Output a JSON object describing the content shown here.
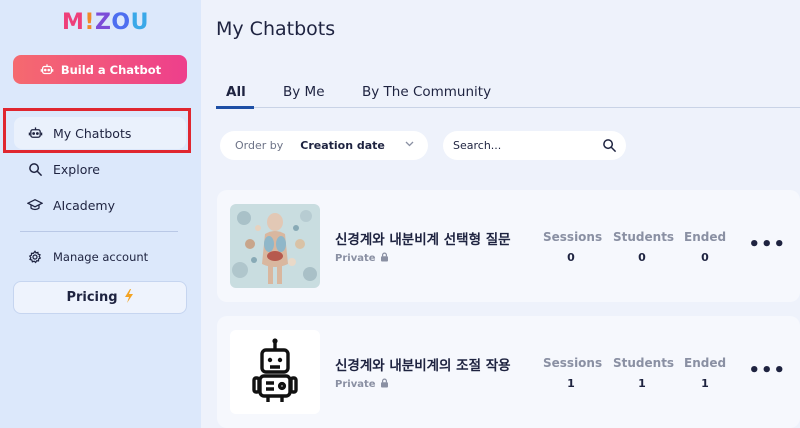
{
  "brand": {
    "logo": [
      "M",
      "!",
      "Z",
      "O",
      "U"
    ]
  },
  "sidebar": {
    "build_label": "Build a Chatbot",
    "items": [
      {
        "label": "My Chatbots",
        "icon": "robot-icon"
      },
      {
        "label": "Explore",
        "icon": "search-icon"
      },
      {
        "label": "AIcademy",
        "icon": "graduation-cap-icon"
      }
    ],
    "manage_label": "Manage account",
    "pricing_label": "Pricing",
    "pricing_icon": "bolt-icon"
  },
  "main": {
    "title": "My Chatbots",
    "tabs": [
      {
        "label": "All",
        "active": true
      },
      {
        "label": "By Me",
        "active": false
      },
      {
        "label": "By The Community",
        "active": false
      }
    ],
    "order": {
      "label": "Order by",
      "value": "Creation date"
    },
    "search": {
      "placeholder": "Search..."
    },
    "chatbots": [
      {
        "title": "신경계와 내분비계 선택형 질문",
        "privacy": "Private",
        "stats": [
          {
            "label": "Sessions",
            "value": "0"
          },
          {
            "label": "Students",
            "value": "0"
          },
          {
            "label": "Ended",
            "value": "0"
          }
        ]
      },
      {
        "title": "신경계와 내분비계의 조절 작용",
        "privacy": "Private",
        "stats": [
          {
            "label": "Sessions",
            "value": "1"
          },
          {
            "label": "Students",
            "value": "1"
          },
          {
            "label": "Ended",
            "value": "1"
          }
        ]
      }
    ]
  },
  "colors": {
    "accent_pink": "#ee3f8c",
    "accent_coral": "#f56a6f",
    "sidebar_bg": "#dce8fb",
    "highlight_red": "#e0262f",
    "tab_underline": "#1e4fa5"
  }
}
